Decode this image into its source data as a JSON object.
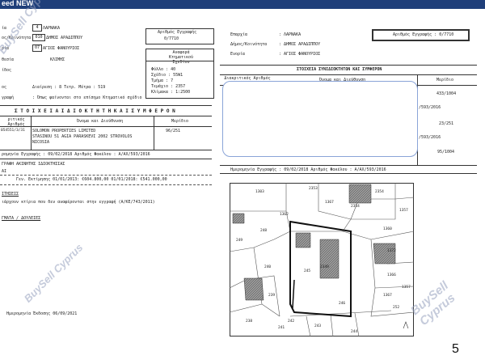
{
  "header": {
    "title": "eed NEW"
  },
  "left_doc": {
    "cert_label": "Αριθμός Εγγραφής",
    "cert_value": "0/7710",
    "rows": [
      {
        "label": "ία",
        "value": "ΛΑΡΝΑΚΑ",
        "code": "4"
      },
      {
        "label": "ος/Κοινότητα",
        "value": "ΔΗΜΟΣ ΑΡΑΔΙΠΠΟΥ",
        "code": "010"
      },
      {
        "label": "ρία",
        "value": "ΑΓΙΟΣ ΦΑΝΟΥΡΙΟΣ",
        "code": "07"
      },
      {
        "label": "θεσία",
        "value": "ΚΛΙΜΗΣ"
      },
      {
        "label": "ίδος",
        "value": ""
      },
      {
        "label": "ος",
        "value": "Διαίρεση : 8          Τετρ. Μέτρα : 519"
      },
      {
        "label": "γραφή",
        "value": ": Όπως φαίνονται στο επίσημο Κτηματικό σχέδιο"
      }
    ],
    "plan_ref": {
      "title": "Αναφορά Κτηματικού Σχεδίου",
      "lines": [
        "Φύλλο : 40",
        "Σχέδιο : 55W1",
        "Τμήμα : 7",
        "Τεμάχιο : 2357",
        "Κλίμακα : 1:2500"
      ]
    },
    "owner_section_title": "Σ Τ Ο Ι Χ Ε Ι Α   Ι Δ Ι Ο Κ Τ Η Τ Η   Κ Α Ι   Σ Υ Μ Φ Ε Ρ Ο Ν",
    "owner_headers": [
      "ριτικός Αριθμός",
      "Όνομα και Διεύθυνση",
      "Μερίδιο"
    ],
    "owner_row": {
      "id": "054551/3/31",
      "name": "SOLOMON PROPERTIES LIMITED",
      "address1": "STASINOU 51 AGIA PARASKEVI 2002 STROVOLOS",
      "address2": "NICOSIA",
      "share": "96/251"
    },
    "registration_line": "ρομηνία Εγγραφής : 09/02/2018          Αριθμός Φακέλου : Α/ΑΧ/593/2016",
    "valuation_title": "ΓΡΑΦΗ ΑΚΙΝΗΤΗΣ ΙΔΙΟΚΤΗΣΙΑΣ",
    "valuation_sub": "ΑΙ",
    "valuation_line": "Γεν. Εκτίμησης 01/01/2013: €604.800,00          01/01/2018: €541.000,00",
    "notes_title": "ΙΤΗΣΕΙΣ",
    "notes_line": "ιάρχουν κτίρια που δεν αναφέρονται στην εγγραφή  (Α/ΚΕ/743/2011)",
    "encumbrance_title": "ΓΜΑΤΑ / ΔΟΥΛΕΙΕΣ",
    "issue_date": "Ημερομηνία Έκδοσης 06/09/2021"
  },
  "right_doc": {
    "rows": [
      {
        "label": "Επαρχία",
        "value": ": ΛΑΡΝΑΚΑ"
      },
      {
        "label": "Δήμος/Κοινότητα",
        "value": ": ΔΗΜΟΣ ΑΡΑΔΙΠΠΟΥ"
      },
      {
        "label": "Ενορία",
        "value": ": ΑΓΙΟΣ ΦΑΝΟΥΡΙΟΣ"
      }
    ],
    "cert_label": "Αριθμός Εγγραφής : 0/7710",
    "section_title": "ΣΤΟΙΧΕΙΑ ΣΥΝΙΔΙΟΚΤΗΤΩΝ ΚΑΙ ΣΥΜΦΕΡΟΝ",
    "headers": [
      "Διακριτικός Αριθμός",
      "Όνομα και Διεύθυνση",
      "Μερίδιο"
    ],
    "shares": [
      "433/1004",
      "/593/2016",
      "23/251",
      "/593/2016",
      "95/1004"
    ],
    "registration_line": "Ημερομηνία Εγγραφής : 09/02/2018          Αριθμός Φακέλου : Α/ΑΧ/593/2016"
  },
  "map": {
    "parcels": [
      "1303",
      "1362",
      "2353",
      "1367",
      "2354",
      "2354",
      "1357",
      "1360",
      "1372",
      "1366",
      "249",
      "248",
      "242",
      "243",
      "241",
      "1367",
      "1357",
      "2349",
      "244",
      "245",
      "240",
      "246",
      "239",
      "252",
      "238"
    ]
  },
  "watermarks": [
    "BuySell Cyprus",
    "BuySell Cyprus",
    "BuySell Cyprus"
  ],
  "page_number": "5"
}
